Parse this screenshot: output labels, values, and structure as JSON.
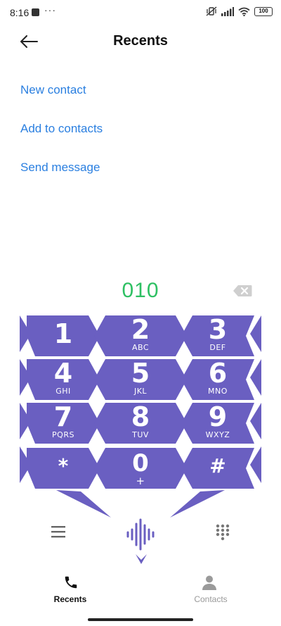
{
  "status_bar": {
    "time": "8:16",
    "dots": "···",
    "battery": "100"
  },
  "header": {
    "title": "Recents"
  },
  "actions": [
    {
      "label": "New contact"
    },
    {
      "label": "Add to contacts"
    },
    {
      "label": "Send message"
    }
  ],
  "dialer": {
    "number": "010",
    "keys": [
      {
        "digit": "1",
        "letters": ""
      },
      {
        "digit": "2",
        "letters": "ABC"
      },
      {
        "digit": "3",
        "letters": "DEF"
      },
      {
        "digit": "4",
        "letters": "GHI"
      },
      {
        "digit": "5",
        "letters": "JKL"
      },
      {
        "digit": "6",
        "letters": "MNO"
      },
      {
        "digit": "7",
        "letters": "PQRS"
      },
      {
        "digit": "8",
        "letters": "TUV"
      },
      {
        "digit": "9",
        "letters": "WXYZ"
      },
      {
        "digit": "*",
        "letters": ""
      },
      {
        "digit": "0",
        "letters": "+"
      },
      {
        "digit": "#",
        "letters": ""
      }
    ]
  },
  "bottom_nav": {
    "items": [
      {
        "label": "Recents",
        "icon": "phone-icon",
        "active": true
      },
      {
        "label": "Contacts",
        "icon": "person-icon",
        "active": false
      }
    ]
  },
  "colors": {
    "accent_link": "#2a7fe0",
    "number": "#2ec063",
    "keypad": "#6a5fc1",
    "active_nav": "#111111",
    "inactive_nav": "#999999"
  }
}
